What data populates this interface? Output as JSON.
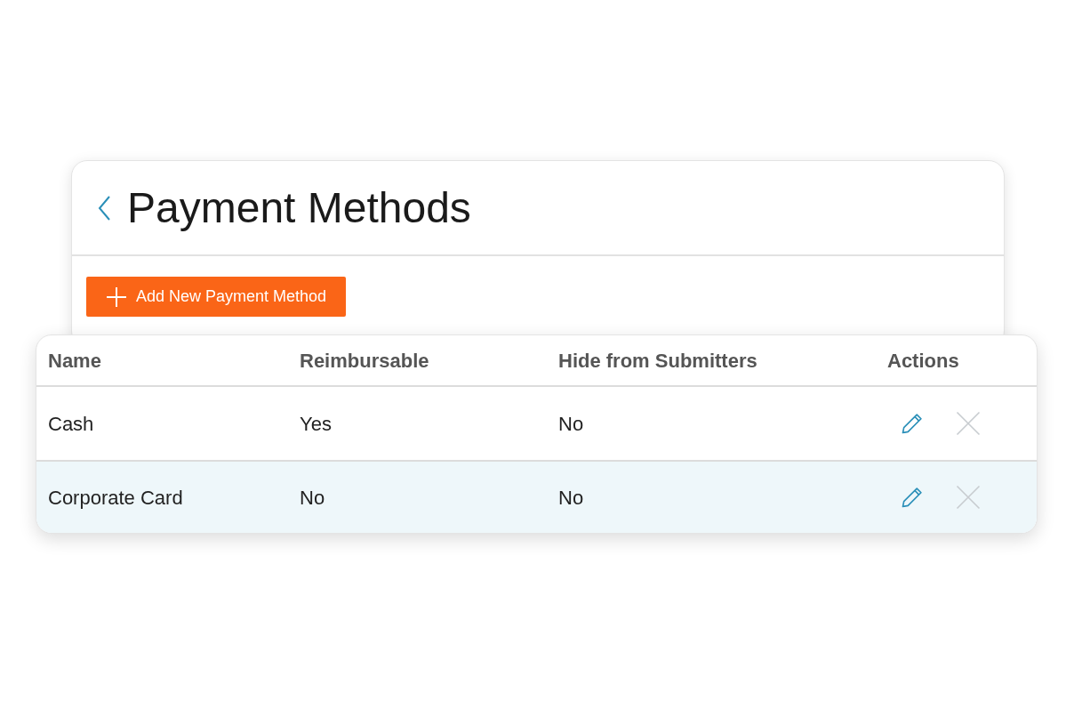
{
  "page": {
    "title": "Payment Methods"
  },
  "add_button": {
    "label": "Add New Payment Method"
  },
  "table": {
    "columns": [
      "Name",
      "Reimbursable",
      "Hide from Submitters",
      "Actions"
    ],
    "rows": [
      {
        "name": "Cash",
        "reimbursable": "Yes",
        "hide_from_submitters": "No",
        "selected": false
      },
      {
        "name": "Corporate Card",
        "reimbursable": "No",
        "hide_from_submitters": "No",
        "selected": true
      }
    ]
  }
}
